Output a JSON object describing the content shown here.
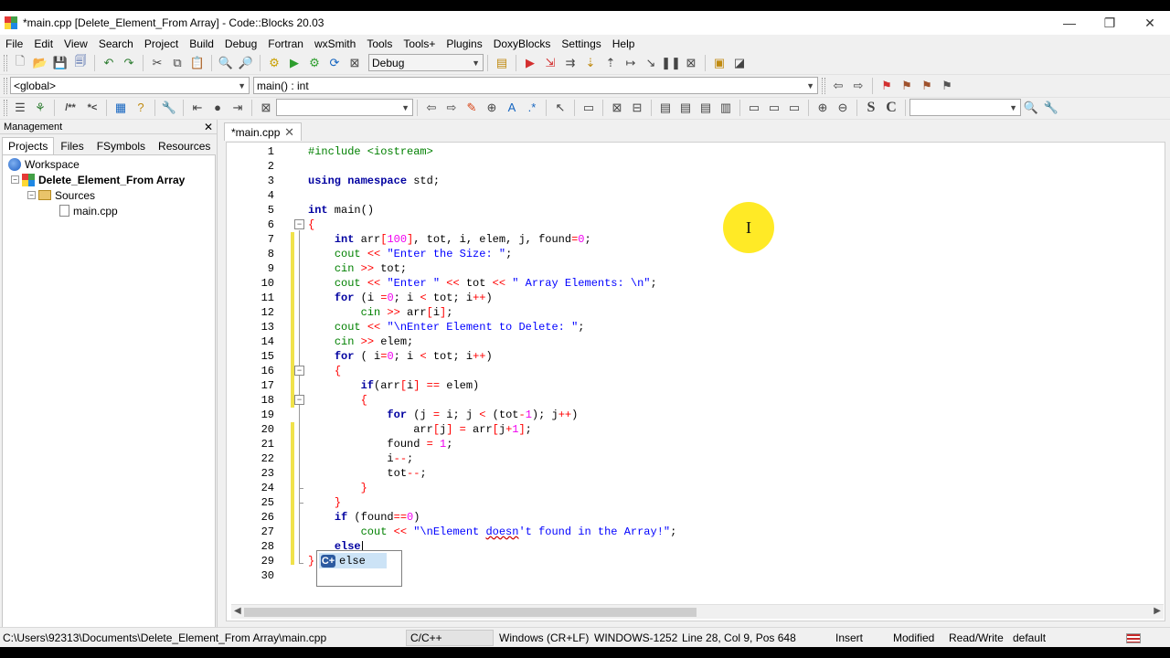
{
  "window": {
    "title": "*main.cpp [Delete_Element_From Array] - Code::Blocks 20.03",
    "controls": {
      "minimize": "—",
      "maximize": "❐",
      "close": "✕"
    }
  },
  "menu": [
    "File",
    "Edit",
    "View",
    "Search",
    "Project",
    "Build",
    "Debug",
    "Fortran",
    "wxSmith",
    "Tools",
    "Tools+",
    "Plugins",
    "DoxyBlocks",
    "Settings",
    "Help"
  ],
  "toolbar": {
    "build_target": "Debug",
    "scope": "<global>",
    "function": "main() : int",
    "doxy_comment": "/**",
    "doxy_inline": "*<",
    "search_s": "S",
    "search_c": "C"
  },
  "management": {
    "title": "Management",
    "close": "✕",
    "tabs": [
      "Projects",
      "Files",
      "FSymbols",
      "Resources"
    ],
    "tree": {
      "workspace": "Workspace",
      "project": "Delete_Element_From Array",
      "sources": "Sources",
      "file": "main.cpp"
    }
  },
  "editor": {
    "tab_label": "*main.cpp",
    "tab_close": "✕",
    "line_numbers": [
      "1",
      "2",
      "3",
      "4",
      "5",
      "6",
      "7",
      "8",
      "9",
      "10",
      "11",
      "12",
      "13",
      "14",
      "15",
      "16",
      "17",
      "18",
      "19",
      "20",
      "21",
      "22",
      "23",
      "24",
      "25",
      "26",
      "27",
      "28",
      "29",
      "30"
    ],
    "autocomplete_item": "else",
    "autocomplete_icon": "C+"
  },
  "statusbar": {
    "path": "C:\\Users\\92313\\Documents\\Delete_Element_From Array\\main.cpp",
    "language": "C/C++",
    "line_endings": "Windows (CR+LF)",
    "encoding": "WINDOWS-1252",
    "position": "Line 28, Col 9, Pos 648",
    "mode": "Insert",
    "modified": "Modified",
    "access": "Read/Write",
    "profile": "default"
  }
}
